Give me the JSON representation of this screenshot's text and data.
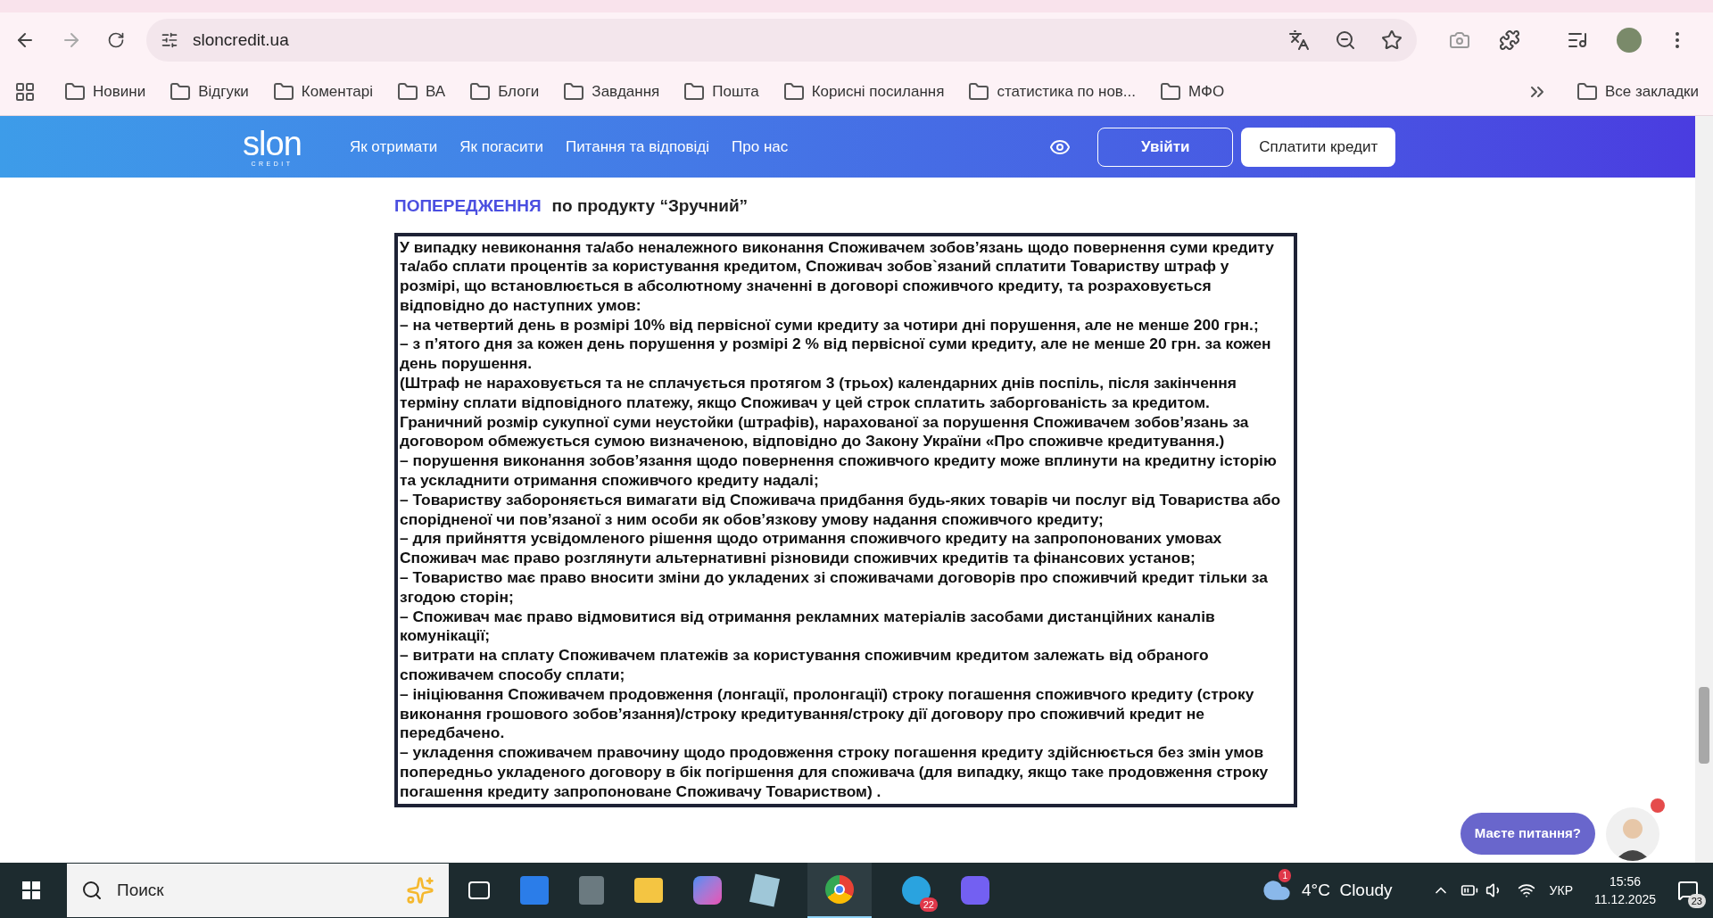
{
  "browser": {
    "url": "sloncredit.ua",
    "bookmarks": [
      "Новини",
      "Відгуки",
      "Коментарі",
      "ВА",
      "Блоги",
      "Завдання",
      "Пошта",
      "Корисні посилання",
      "статистика по нов...",
      "МФО"
    ],
    "all_bookmarks": "Все закладки"
  },
  "site_header": {
    "logo": "slon",
    "logo_sub": "CREDIT",
    "nav": [
      "Як отримати",
      "Як погасити",
      "Питання та відповіді",
      "Про нас"
    ],
    "login": "Увійти",
    "pay": "Сплатити кредит"
  },
  "warning": {
    "title": "ПОПЕРЕДЖЕННЯ",
    "subtitle": "по продукту “Зручний”",
    "paragraphs": [
      "У випадку невиконання та/або неналежного виконання Споживачем зобов’язань щодо повернення суми кредиту та/або сплати процентів за користування кредитом, Споживач зобов`язаний сплатити Товариству штраф у розмірі, що встановлюється в абсолютному значенні в договорі споживчого кредиту, та розраховується відповідно до наступних умов:",
      "– на четвертий день в розмірі 10% від первісної суми кредиту за чотири дні порушення, але не менше 200 грн.;",
      "– з п’ятого дня за кожен день порушення у розмірі 2 % від первісної суми кредиту, але не менше 20 грн. за кожен день порушення.",
      "(Штраф не нараховується та не сплачується протягом 3 (трьох) календарних днів поспіль, після закінчення терміну сплати відповідного платежу, якщо Споживач у цей строк сплатить заборгованість за кредитом.",
      "Граничний розмір сукупної суми неустойки (штрафів), нарахованої за порушення Споживачем зобов’язань за договором обмежується сумою визначеною, відповідно до Закону України «Про споживче кредитування.)",
      "– порушення виконання зобов’язання щодо повернення споживчого кредиту може вплинути на кредитну історію та ускладнити отримання споживчого кредиту надалі;",
      "– Товариству забороняється вимагати від Споживача придбання будь-яких товарів чи послуг від Товариства або спорідненої чи пов’язаної з ним особи як обов’язкову умову надання споживчого кредиту;",
      "– для прийняття усвідомленого рішення щодо отримання споживчого кредиту на запропонованих умовах Споживач має право розглянути альтернативні різновиди споживчих кредитів та фінансових установ;",
      "– Товариство має право вносити зміни до укладених зі споживачами договорів про споживчий кредит тільки за згодою сторін;",
      "– Споживач має право відмовитися від отримання рекламних матеріалів засобами дистанційних каналів комунікації;",
      "– витрати на сплату Споживачем платежів за користування споживчим кредитом залежать від обраного споживачем способу сплати;",
      "– ініціювання Споживачем продовження (лонгації, пролонгації) строку погашення споживчого кредиту (строку виконання грошового зобов’язання)/строку кредитування/строку дії договору про споживчий кредит не передбачено.",
      "– укладення споживачем правочину щодо продовження строку погашення кредиту здійснюється без змін умов попередньо укладеного договору в бік погіршення для споживача (для випадку, якщо таке продовження строку погашення кредиту запропоноване Споживачу Товариством) ."
    ]
  },
  "chat": {
    "bubble": "Маєте питання?"
  },
  "taskbar": {
    "search": "Поиск",
    "telegram_badge": "22",
    "weather_badge": "1",
    "weather": "4°C  Cloudy",
    "language": "УКР",
    "time": "15:56",
    "date": "11.12.2025",
    "notifications": "23"
  }
}
